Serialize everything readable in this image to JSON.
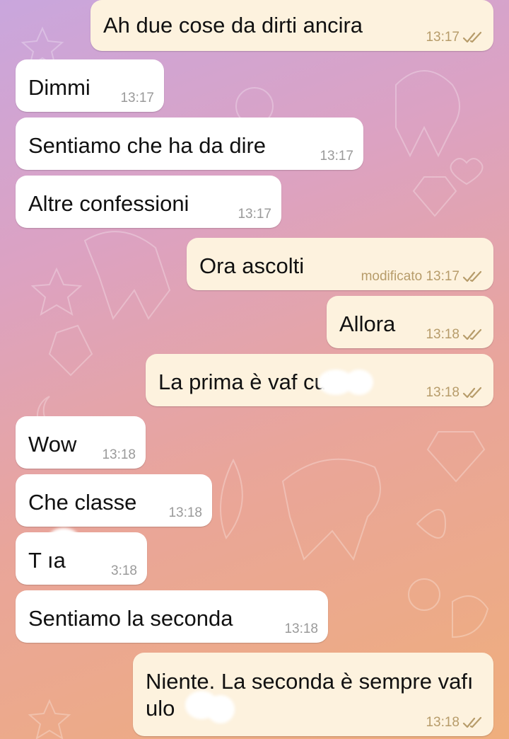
{
  "colors": {
    "incoming_bubble": "#ffffff",
    "outgoing_bubble": "#fdf2de",
    "timestamp_in": "#9a9a9a",
    "timestamp_out": "#b79c6a",
    "tick_color": "#b79c6a"
  },
  "messages": [
    {
      "dir": "out",
      "text": "Ah due cose da dirti ancira",
      "time": "13:17",
      "ticks": "double-check-icon"
    },
    {
      "dir": "in",
      "text": "Dimmi",
      "time": "13:17"
    },
    {
      "dir": "in",
      "text": "Sentiamo che ha da dire",
      "time": "13:17"
    },
    {
      "dir": "in",
      "text": "Altre confessioni",
      "time": "13:17"
    },
    {
      "dir": "out",
      "text": "Ora ascolti",
      "time": "modificato 13:17",
      "ticks": "double-check-icon"
    },
    {
      "dir": "out",
      "text": "Allora",
      "time": "13:18",
      "ticks": "double-check-icon"
    },
    {
      "dir": "out",
      "text": "La prima è vaf culo",
      "time": "13:18",
      "ticks": "double-check-icon"
    },
    {
      "dir": "in",
      "text": "Wow",
      "time": "13:18"
    },
    {
      "dir": "in",
      "text": "Che classe",
      "time": "13:18"
    },
    {
      "dir": "in",
      "text": "T ıa",
      "time": "3:18"
    },
    {
      "dir": "in",
      "text": "Sentiamo la seconda",
      "time": "13:18"
    },
    {
      "dir": "out",
      "text": "Niente. La seconda è sempre vafı ulo",
      "time": "13:18",
      "ticks": "double-check-icon"
    }
  ]
}
